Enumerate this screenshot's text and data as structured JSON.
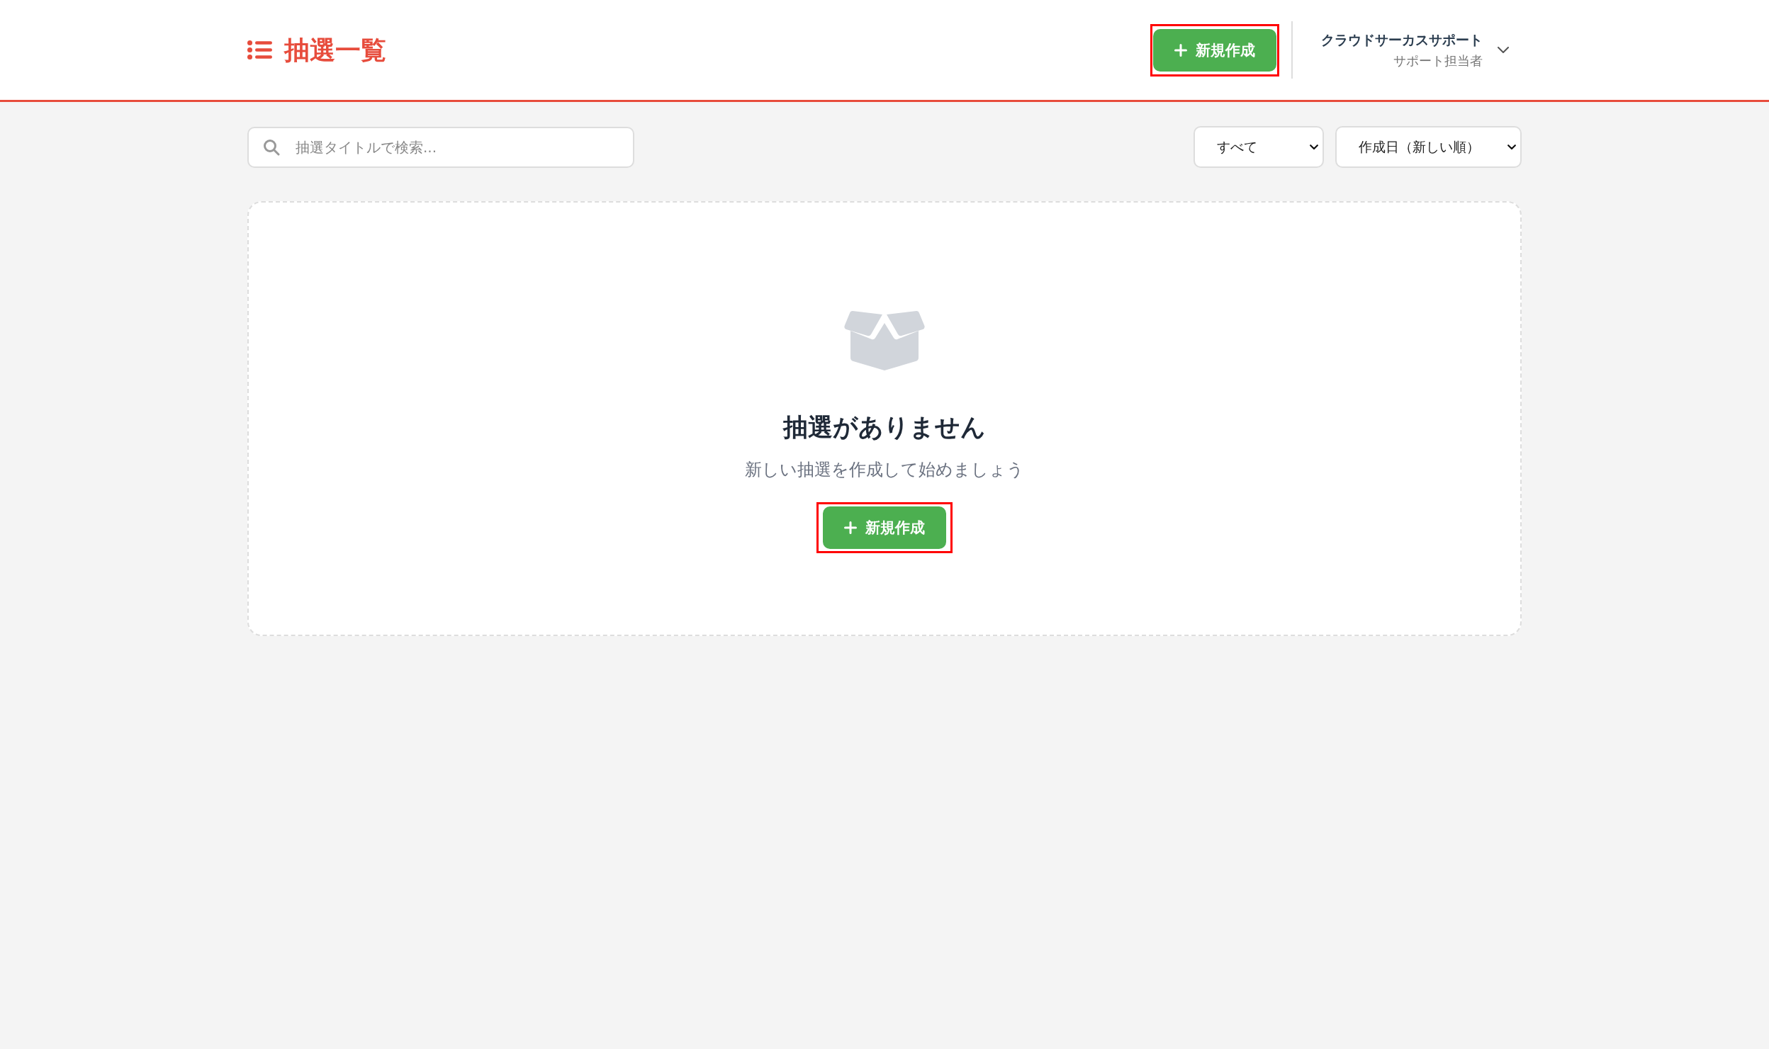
{
  "header": {
    "title": "抽選一覧",
    "new_button": {
      "label": "新規作成",
      "highlighted": true
    },
    "user": {
      "name": "クラウドサーカスサポート",
      "role": "サポート担当者"
    }
  },
  "toolbar": {
    "search": {
      "placeholder": "抽選タイトルで検索..."
    },
    "filters": [
      {
        "value": "すべて"
      },
      {
        "value": "作成日（新しい順）"
      }
    ]
  },
  "empty_state": {
    "title": "抽選がありません",
    "message": "新しい抽選を作成して始めましょう",
    "button": {
      "label": "新規作成",
      "highlighted": true
    }
  }
}
